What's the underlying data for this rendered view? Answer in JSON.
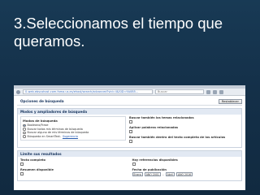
{
  "slide": {
    "title": "3.Seleccionamos el tiempo que queramos."
  },
  "browser": {
    "url": "0-web.ebscohost.com.fama.us.es/ehost/search/advanced?vid=4&SID=9A0B5...",
    "search_placeholder": "Buscar"
  },
  "page": {
    "options_title": "Opciones de búsqueda",
    "reset_button": "Restablecer",
    "modes_section": {
      "title": "Modos y ampliadores de búsqueda",
      "modes_box_title": "Modos de búsqueda",
      "radio_options": [
        {
          "label": "Booleano/Frase",
          "checked": true
        },
        {
          "label": "Buscar todos mis términos de búsqueda",
          "checked": false
        },
        {
          "label": "Buscar alguno de mis términos de búsqueda",
          "checked": false
        },
        {
          "label": "Búsqueda en SmartText.",
          "link": "Sugerencia",
          "checked": false
        }
      ],
      "right_options": [
        "Buscar también los temas relacionados",
        "Aplicar palabras relacionadas",
        "Buscar también dentro del texto completo de los artículos"
      ]
    },
    "limits_section": {
      "title": "Limite sus resultados",
      "left_options": [
        "Texto completo",
        "Resumen disponible"
      ],
      "right_options": [
        "Hay referencias disponibles"
      ],
      "date_label": "Fecha de publicación",
      "date_from": {
        "month": "Enero",
        "year": "AÑO 2001"
      },
      "date_to": {
        "month": "Abril",
        "year": "AÑO 2016"
      },
      "date_separator": "–"
    }
  }
}
